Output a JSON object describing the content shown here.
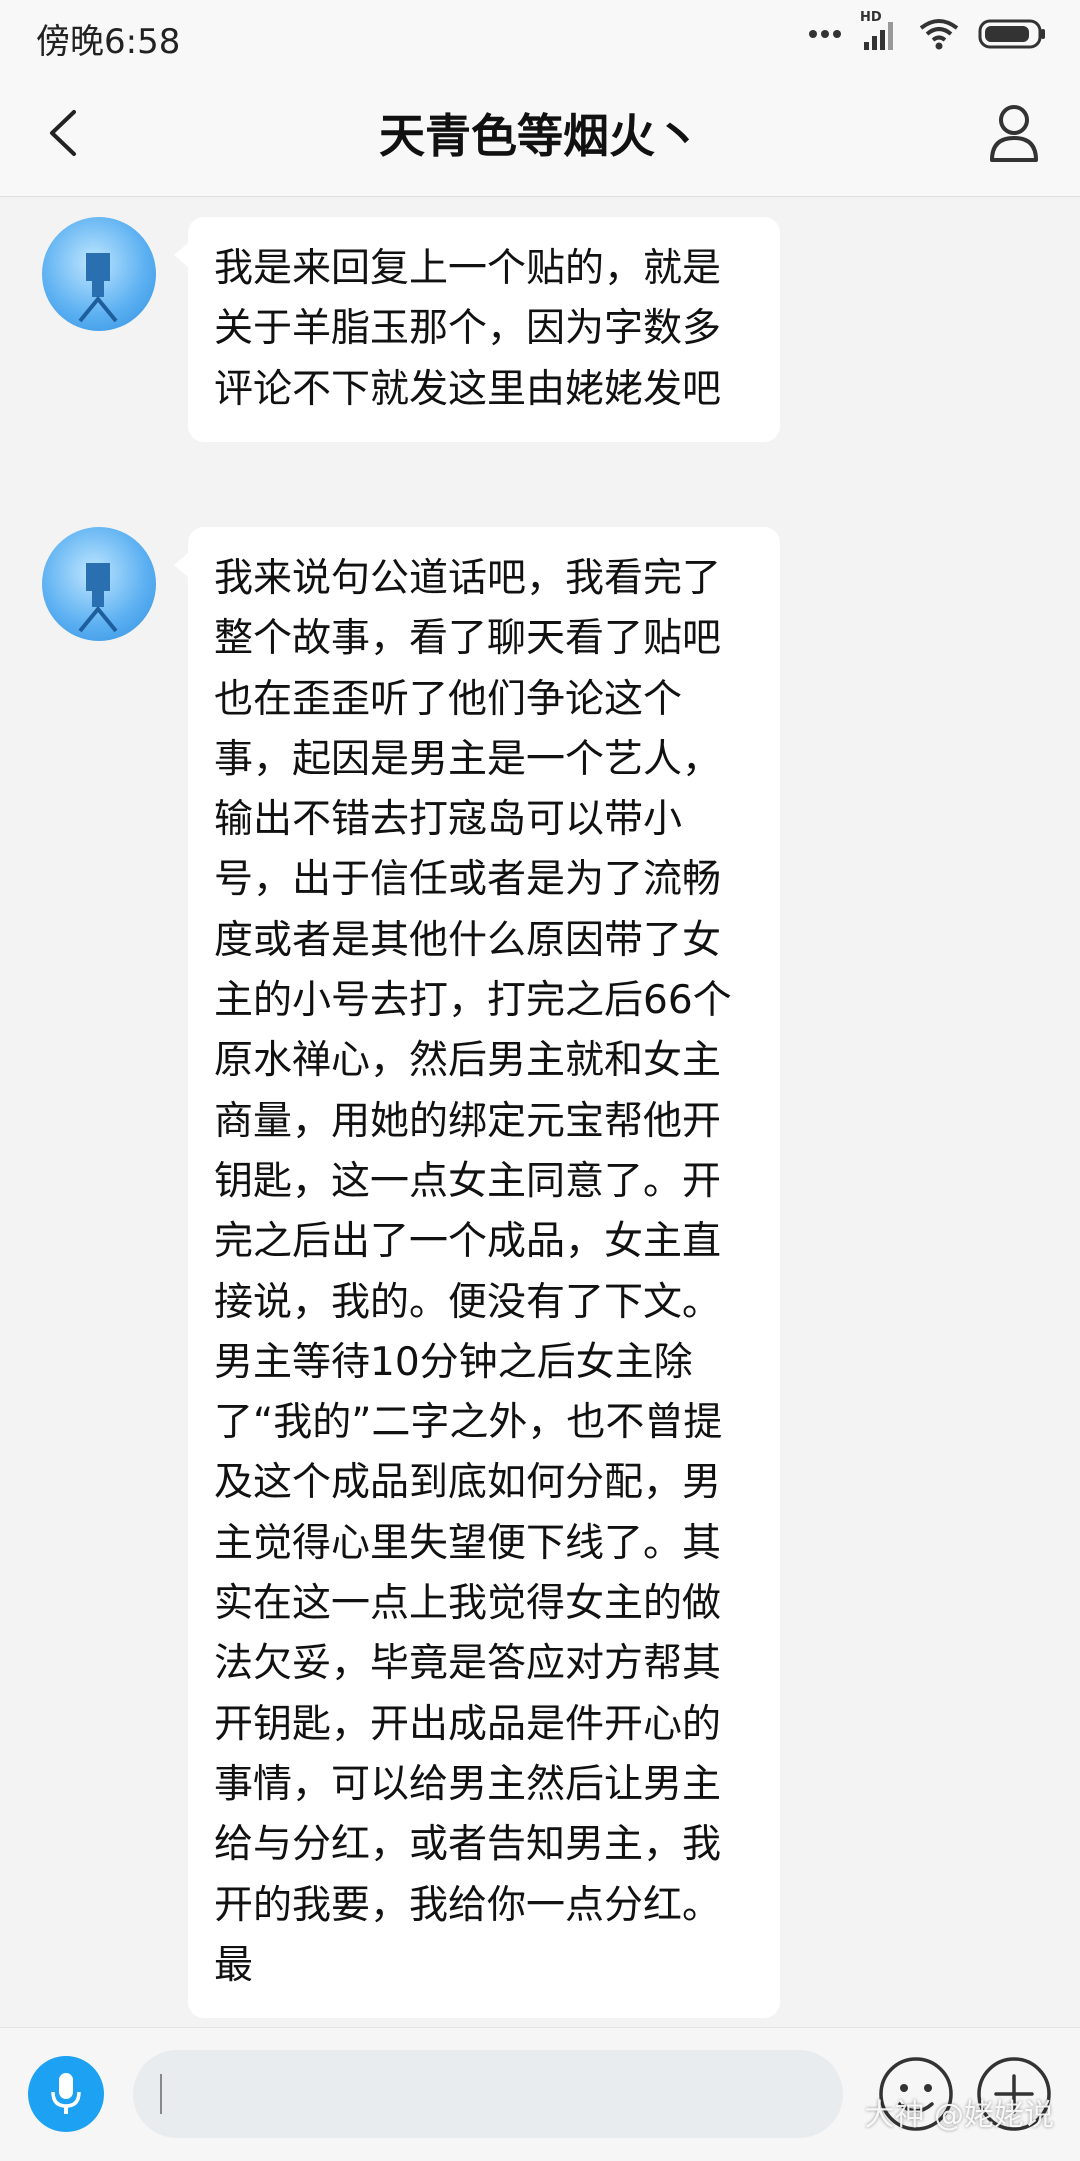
{
  "status_bar": {
    "time": "傍晚6:58",
    "network_label": "HD"
  },
  "header": {
    "title": "天青色等烟火丶"
  },
  "messages": [
    {
      "text": "我是来回复上一个贴的，就是关于羊脂玉那个，因为字数多评论不下就发这里由姥姥发吧"
    },
    {
      "text": "我来说句公道话吧，我看完了整个故事，看了聊天看了贴吧也在歪歪听了他们争论这个事，起因是男主是一个艺人，输出不错去打寇岛可以带小号，出于信任或者是为了流畅度或者是其他什么原因带了女主的小号去打，打完之后66个原水禅心，然后男主就和女主商量，用她的绑定元宝帮他开钥匙，这一点女主同意了。开完之后出了一个成品，女主直接说，我的。便没有了下文。男主等待10分钟之后女主除了“我的”二字之外，也不曾提及这个成品到底如何分配，男主觉得心里失望便下线了。其实在这一点上我觉得女主的做法欠妥，毕竟是答应对方帮其开钥匙，开出成品是件开心的事情，可以给男主然后让男主给与分红，或者告知男主，我开的我要，我给你一点分红。最"
    }
  ],
  "input_bar": {
    "placeholder": ""
  },
  "watermark": "大神 @姥姥说",
  "colors": {
    "accent": "#1da1f2",
    "bubble": "#ffffff",
    "background": "#f3f3f3"
  }
}
